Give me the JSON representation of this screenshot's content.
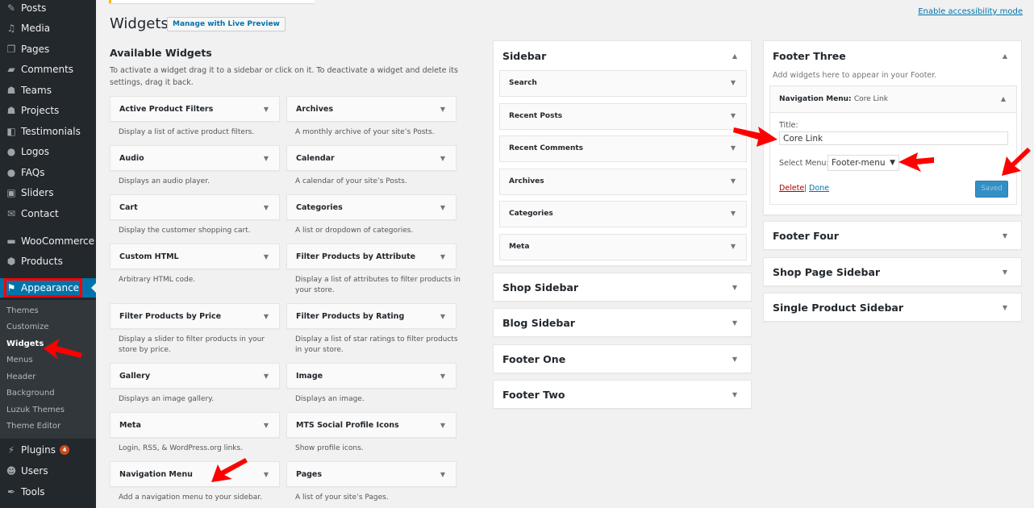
{
  "admin_menu": {
    "items": [
      {
        "label": "Posts",
        "icon": "pushpin-icon"
      },
      {
        "label": "Media",
        "icon": "media-icon"
      },
      {
        "label": "Pages",
        "icon": "pages-icon"
      },
      {
        "label": "Comments",
        "icon": "comments-icon"
      },
      {
        "label": "Teams",
        "icon": "groups-icon"
      },
      {
        "label": "Projects",
        "icon": "groups-icon"
      },
      {
        "label": "Testimonials",
        "icon": "testimonial-icon"
      },
      {
        "label": "Logos",
        "icon": "globe-icon"
      },
      {
        "label": "FAQs",
        "icon": "faq-bubble-icon"
      },
      {
        "label": "Sliders",
        "icon": "sliders-icon"
      },
      {
        "label": "Contact",
        "icon": "envelope-icon"
      },
      {
        "label": "WooCommerce",
        "icon": "woocommerce-icon"
      },
      {
        "label": "Products",
        "icon": "box-icon"
      },
      {
        "label": "Appearance",
        "icon": "paintbrush-icon",
        "current": true
      },
      {
        "label": "Plugins",
        "icon": "plug-icon",
        "badge": "4"
      },
      {
        "label": "Users",
        "icon": "user-icon"
      },
      {
        "label": "Tools",
        "icon": "wrench-icon"
      }
    ],
    "appearance_submenu": [
      {
        "label": "Themes"
      },
      {
        "label": "Customize"
      },
      {
        "label": "Widgets",
        "current": true
      },
      {
        "label": "Menus"
      },
      {
        "label": "Header"
      },
      {
        "label": "Background"
      },
      {
        "label": "Luzuk Themes"
      },
      {
        "label": "Theme Editor"
      }
    ]
  },
  "header": {
    "title": "Widgets",
    "live_preview_label": "Manage with Live Preview",
    "accessibility_link": "Enable accessibility mode"
  },
  "available_widgets": {
    "title": "Available Widgets",
    "description": "To activate a widget drag it to a sidebar or click on it. To deactivate a widget and delete its settings, drag it back.",
    "widgets": [
      {
        "name": "Active Product Filters",
        "desc": "Display a list of active product filters."
      },
      {
        "name": "Archives",
        "desc": "A monthly archive of your site’s Posts."
      },
      {
        "name": "Audio",
        "desc": "Displays an audio player."
      },
      {
        "name": "Calendar",
        "desc": "A calendar of your site’s Posts."
      },
      {
        "name": "Cart",
        "desc": "Display the customer shopping cart."
      },
      {
        "name": "Categories",
        "desc": "A list or dropdown of categories."
      },
      {
        "name": "Custom HTML",
        "desc": "Arbitrary HTML code."
      },
      {
        "name": "Filter Products by Attribute",
        "desc": "Display a list of attributes to filter products in your store."
      },
      {
        "name": "Filter Products by Price",
        "desc": "Display a slider to filter products in your store by price."
      },
      {
        "name": "Filter Products by Rating",
        "desc": "Display a list of star ratings to filter products in your store."
      },
      {
        "name": "Gallery",
        "desc": "Displays an image gallery."
      },
      {
        "name": "Image",
        "desc": "Displays an image."
      },
      {
        "name": "Meta",
        "desc": "Login, RSS, & WordPress.org links."
      },
      {
        "name": "MTS Social Profile Icons",
        "desc": "Show profile icons."
      },
      {
        "name": "Navigation Menu",
        "desc": "Add a navigation menu to your sidebar."
      },
      {
        "name": "Pages",
        "desc": "A list of your site’s Pages."
      }
    ]
  },
  "sidebars_col1": {
    "sidebar": {
      "title": "Sidebar",
      "widgets": [
        "Search",
        "Recent Posts",
        "Recent Comments",
        "Archives",
        "Categories",
        "Meta"
      ]
    },
    "collapsed": [
      "Shop Sidebar",
      "Blog Sidebar",
      "Footer One",
      "Footer Two"
    ]
  },
  "sidebars_col2": {
    "footer_three": {
      "title": "Footer Three",
      "description": "Add widgets here to appear in your Footer.",
      "nav_widget": {
        "title_prefix": "Navigation Menu:",
        "title_suffix": "Core Link",
        "title_label": "Title:",
        "title_value": "Core Link",
        "select_label": "Select Menu:",
        "select_value": "Footer-menu",
        "delete_label": "Delete",
        "separator": "|",
        "done_label": "Done",
        "saved_label": "Saved"
      }
    },
    "collapsed": [
      "Footer Four",
      "Shop Page Sidebar",
      "Single Product Sidebar"
    ]
  },
  "icons": {
    "arrow_down": "▼",
    "arrow_up": "▲"
  },
  "colors": {
    "accent": "#0073aa",
    "menu_bg": "#23282d",
    "submenu_bg": "#32373c",
    "badge": "#ca4a1f",
    "annotation": "#ff0000"
  }
}
